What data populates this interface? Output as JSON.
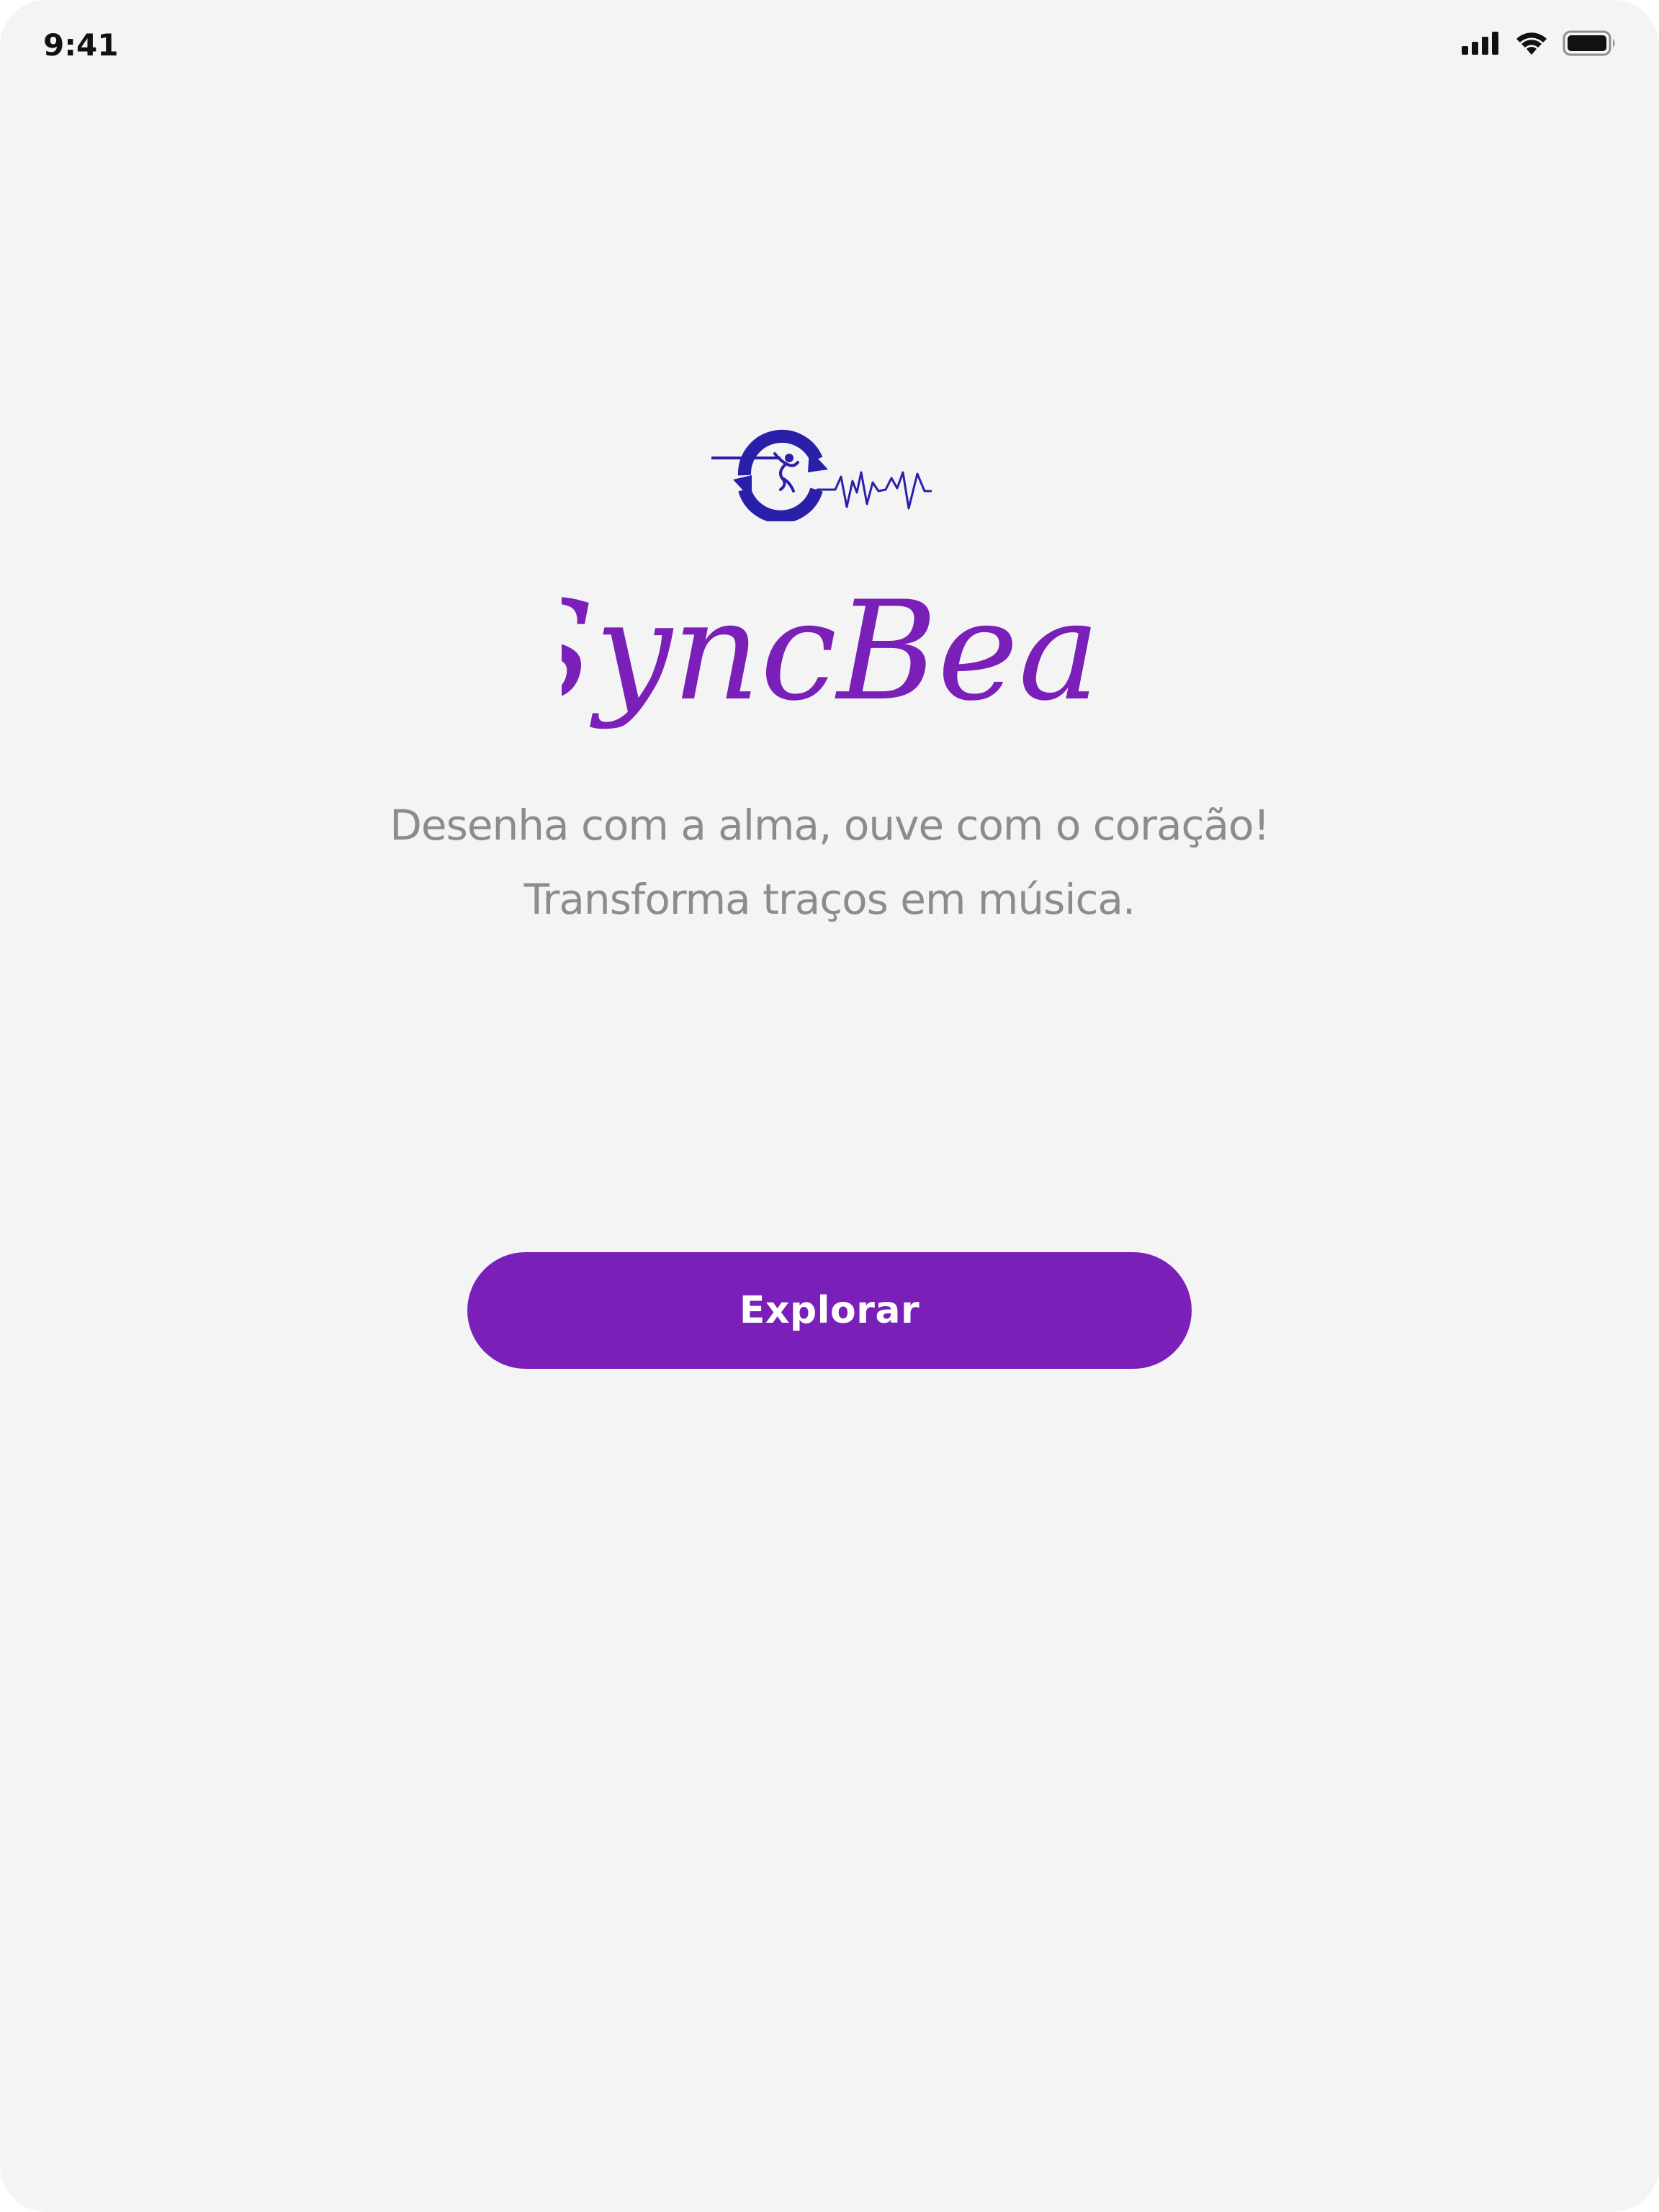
{
  "status_bar": {
    "time": "9:41",
    "icons": [
      "cellular-signal-icon",
      "wifi-icon",
      "battery-icon"
    ]
  },
  "brand": {
    "name": "SyncBeat",
    "logo": "sync-heartbeat-logo",
    "colors": {
      "logo": "#2a1fa8",
      "wordmark": "#7a20b8"
    }
  },
  "tagline": {
    "line1": "Desenha com a alma, ouve com o coração!",
    "line2": "Transforma traços em música."
  },
  "cta": {
    "label": "Explorar",
    "color": "#7a20b8"
  }
}
